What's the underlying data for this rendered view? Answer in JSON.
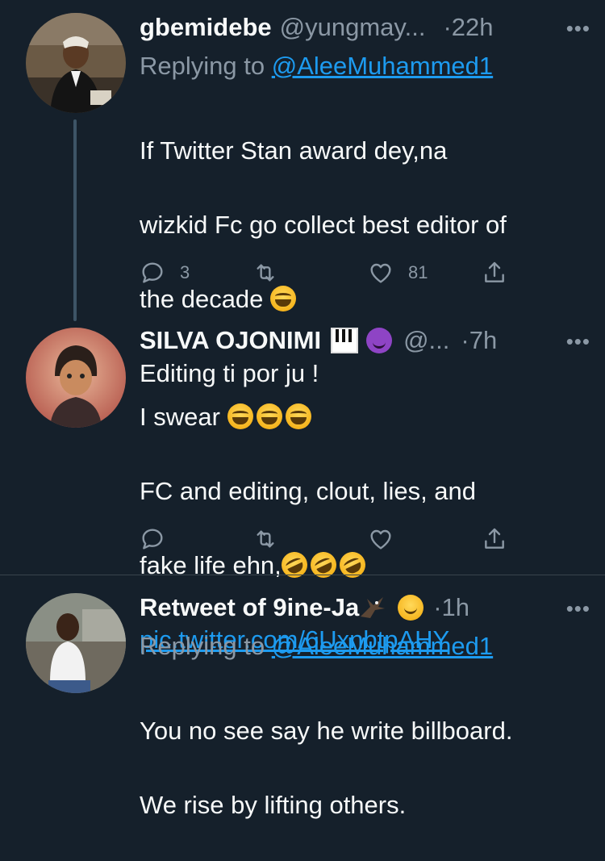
{
  "tweets": [
    {
      "name": "gbemidebe",
      "handle": "@yungmay...",
      "time": "22h",
      "more": "•••",
      "replying_prefix": "Replying to ",
      "replying_to": "@AleeMuhammed1",
      "text_lines": [
        "If Twitter Stan award dey,na",
        "wizkid Fc go collect best editor of",
        "the decade",
        "Editing ti por ju !"
      ],
      "replies": "3",
      "likes": "81"
    },
    {
      "name": "SILVA OJONIMI",
      "handle": "@...",
      "time": "7h",
      "more": "•••",
      "text_lines": [
        "I swear",
        "FC and editing, clout, lies, and",
        "fake life ehn,"
      ],
      "link": "pic.twitter.com/6UxnbtpAHY"
    },
    {
      "name": "Retweet of 9ine-Ja",
      "time": "1h",
      "more": "•••",
      "replying_prefix": "Replying to ",
      "replying_to": "@AleeMuhammed1",
      "text_lines": [
        "You no see say he write billboard.",
        "We rise by lifting others."
      ]
    }
  ],
  "separator": "·",
  "icons": {
    "reply": "reply-icon",
    "retweet": "retweet-icon",
    "like": "heart-icon",
    "share": "share-icon",
    "more": "more-icon"
  },
  "colors": {
    "background": "#15202b",
    "text": "#f7f9f9",
    "muted": "#8b98a5",
    "link": "#1d9bf0"
  }
}
